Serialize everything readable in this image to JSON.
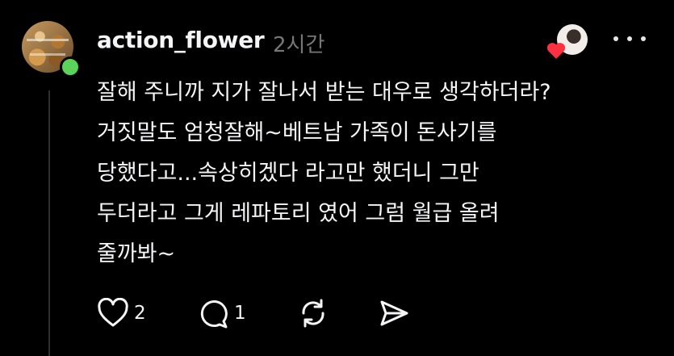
{
  "header": {
    "username": "action_flower",
    "time": "2시간"
  },
  "post": {
    "lines": [
      "잘해 주니까 지가 잘나서 받는 대우로 생각하더라?",
      "거짓말도 엄청잘해~베트남 가족이 돈사기를",
      "당했다고...속상히겠다 라고만 했더니 그만",
      "두더라고 그게 레파토리 였어 그럼 월급 올려",
      "줄까봐~"
    ]
  },
  "actions": {
    "like_count": "2",
    "comment_count": "1"
  },
  "icons": {
    "like": "heart-icon",
    "comment": "comment-icon",
    "repost": "repost-icon",
    "share": "send-icon",
    "more": "more-icon"
  },
  "colors": {
    "background": "#000000",
    "text": "#f3f5f7",
    "muted": "#777777",
    "online": "#5ad35a",
    "heart": "#ff3040"
  }
}
